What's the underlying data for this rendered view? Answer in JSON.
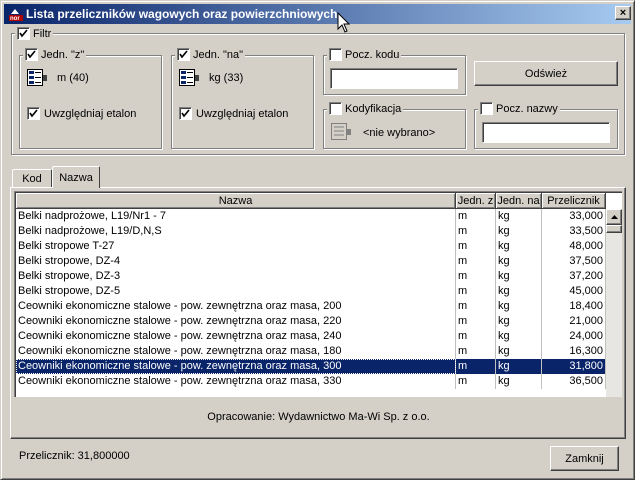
{
  "window": {
    "title": "Lista przeliczników wagowych oraz powierzchniowych",
    "close_label": "×"
  },
  "filter": {
    "label": "Filtr",
    "checked": true,
    "unit_z": {
      "label": "Jedn. \"z\"",
      "value": "m (40)",
      "include_label": "Uwzględniaj etalon"
    },
    "unit_na": {
      "label": "Jedn. \"na\"",
      "value": "kg (33)",
      "include_label": "Uwzględniaj etalon"
    },
    "code_prefix": {
      "label": "Pocz. kodu",
      "value": ""
    },
    "codification": {
      "label": "Kodyfikacja",
      "value": "<nie wybrano>"
    },
    "name_prefix": {
      "label": "Pocz. nazwy",
      "value": ""
    },
    "refresh_label": "Odśwież"
  },
  "tabs": [
    {
      "label": "Kod"
    },
    {
      "label": "Nazwa"
    }
  ],
  "grid": {
    "headers": [
      "Nazwa",
      "Jedn. z",
      "Jedn. na",
      "Przelicznik"
    ],
    "rows": [
      [
        "Belki nadprożowe, L19/Nr1 - 7",
        "m",
        "kg",
        "33,000"
      ],
      [
        "Belki nadprożowe, L19/D,N,S",
        "m",
        "kg",
        "33,500"
      ],
      [
        "Belki stropowe T-27",
        "m",
        "kg",
        "48,000"
      ],
      [
        "Belki stropowe, DZ-4",
        "m",
        "kg",
        "37,500"
      ],
      [
        "Belki stropowe, DZ-3",
        "m",
        "kg",
        "37,200"
      ],
      [
        "Belki stropowe, DZ-5",
        "m",
        "kg",
        "45,000"
      ],
      [
        "Ceowniki ekonomiczne stalowe - pow. zewnętrzna oraz masa, 200",
        "m",
        "kg",
        "18,400"
      ],
      [
        "Ceowniki ekonomiczne stalowe - pow. zewnętrzna oraz masa, 220",
        "m",
        "kg",
        "21,000"
      ],
      [
        "Ceowniki ekonomiczne stalowe - pow. zewnętrzna oraz masa, 240",
        "m",
        "kg",
        "24,000"
      ],
      [
        "Ceowniki ekonomiczne stalowe - pow. zewnętrzna oraz masa, 180",
        "m",
        "kg",
        "16,300"
      ],
      [
        "Ceowniki ekonomiczne stalowe - pow. zewnętrzna oraz masa, 300",
        "m",
        "kg",
        "31,800"
      ],
      [
        "Ceowniki ekonomiczne stalowe - pow. zewnętrzna oraz masa, 330",
        "m",
        "kg",
        "36,500"
      ]
    ],
    "selected_index": 10
  },
  "footer_note": "Opracowanie:  Wydawnictwo Ma-Wi Sp. z o.o.",
  "status": "Przelicznik: 31,800000",
  "close_button_label": "Zamknij",
  "colors": {
    "title_start": "#0a246a",
    "title_end": "#a6caf0",
    "selection": "#0a246a",
    "face": "#d4d0c8"
  }
}
